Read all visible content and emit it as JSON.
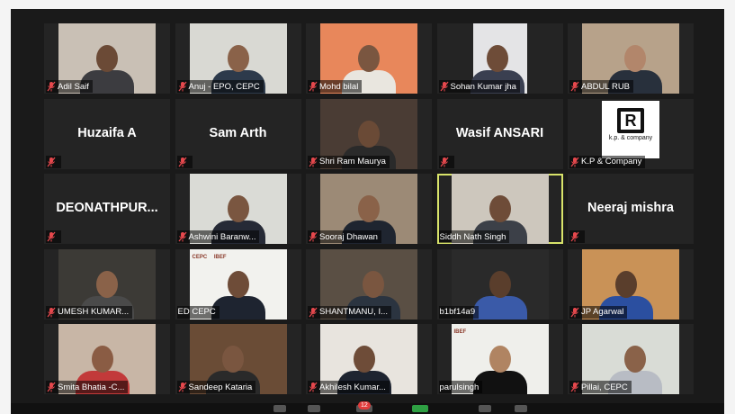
{
  "meeting": {
    "participants": [
      {
        "name": "Adil Saif",
        "muted": true,
        "type": "video"
      },
      {
        "name": "Anuj - EPO, CEPC",
        "muted": true,
        "type": "video"
      },
      {
        "name": "Mohd bilal",
        "muted": true,
        "type": "video"
      },
      {
        "name": "Sohan Kumar jha",
        "muted": true,
        "type": "video"
      },
      {
        "name": "ABDUL RUB",
        "muted": true,
        "type": "video"
      },
      {
        "name": "Huzaifa A",
        "big_name": "Huzaifa A",
        "muted": true,
        "type": "name"
      },
      {
        "name": "Sam Arth",
        "big_name": "Sam Arth",
        "muted": true,
        "type": "name"
      },
      {
        "name": "Shri Ram Maurya",
        "muted": true,
        "type": "video"
      },
      {
        "name": "Wasif ANSARI",
        "big_name": "Wasif ANSARI",
        "muted": true,
        "type": "name"
      },
      {
        "name": "K.P & Company",
        "muted": true,
        "type": "logo",
        "logo_text": "k.p. & company"
      },
      {
        "name": "DEONATHPUR...",
        "big_name": "DEONATHPUR...",
        "muted": true,
        "type": "name"
      },
      {
        "name": "Ashwini Baranw...",
        "muted": true,
        "type": "video"
      },
      {
        "name": "Sooraj Dhawan",
        "muted": true,
        "type": "video"
      },
      {
        "name": "Siddh Nath Singh",
        "muted": false,
        "type": "video",
        "active": true
      },
      {
        "name": "Neeraj mishra",
        "big_name": "Neeraj mishra",
        "muted": true,
        "type": "name"
      },
      {
        "name": "UMESH KUMAR...",
        "muted": true,
        "type": "video"
      },
      {
        "name": "ED CEPC",
        "muted": false,
        "type": "video",
        "backdrop": "CEPC IBEF"
      },
      {
        "name": "SHANTMANU, I...",
        "muted": true,
        "type": "video"
      },
      {
        "name": "b1bf14a9",
        "muted": false,
        "type": "video"
      },
      {
        "name": "JP Agarwal",
        "muted": true,
        "type": "video"
      },
      {
        "name": "Smita Bhatia -C...",
        "muted": true,
        "type": "video"
      },
      {
        "name": "Sandeep Kataria",
        "muted": true,
        "type": "video"
      },
      {
        "name": "Akhilesh Kumar...",
        "muted": true,
        "type": "video"
      },
      {
        "name": "parulsingh",
        "muted": false,
        "type": "video",
        "backdrop": "IBEF"
      },
      {
        "name": "Pillai, CEPC",
        "muted": true,
        "type": "video"
      }
    ],
    "toolbar": {
      "chat_badge": "12"
    }
  },
  "colors": {
    "muted_icon": "#e5484d",
    "active_border": "#d8e36a",
    "tile_bg": "#242424"
  }
}
